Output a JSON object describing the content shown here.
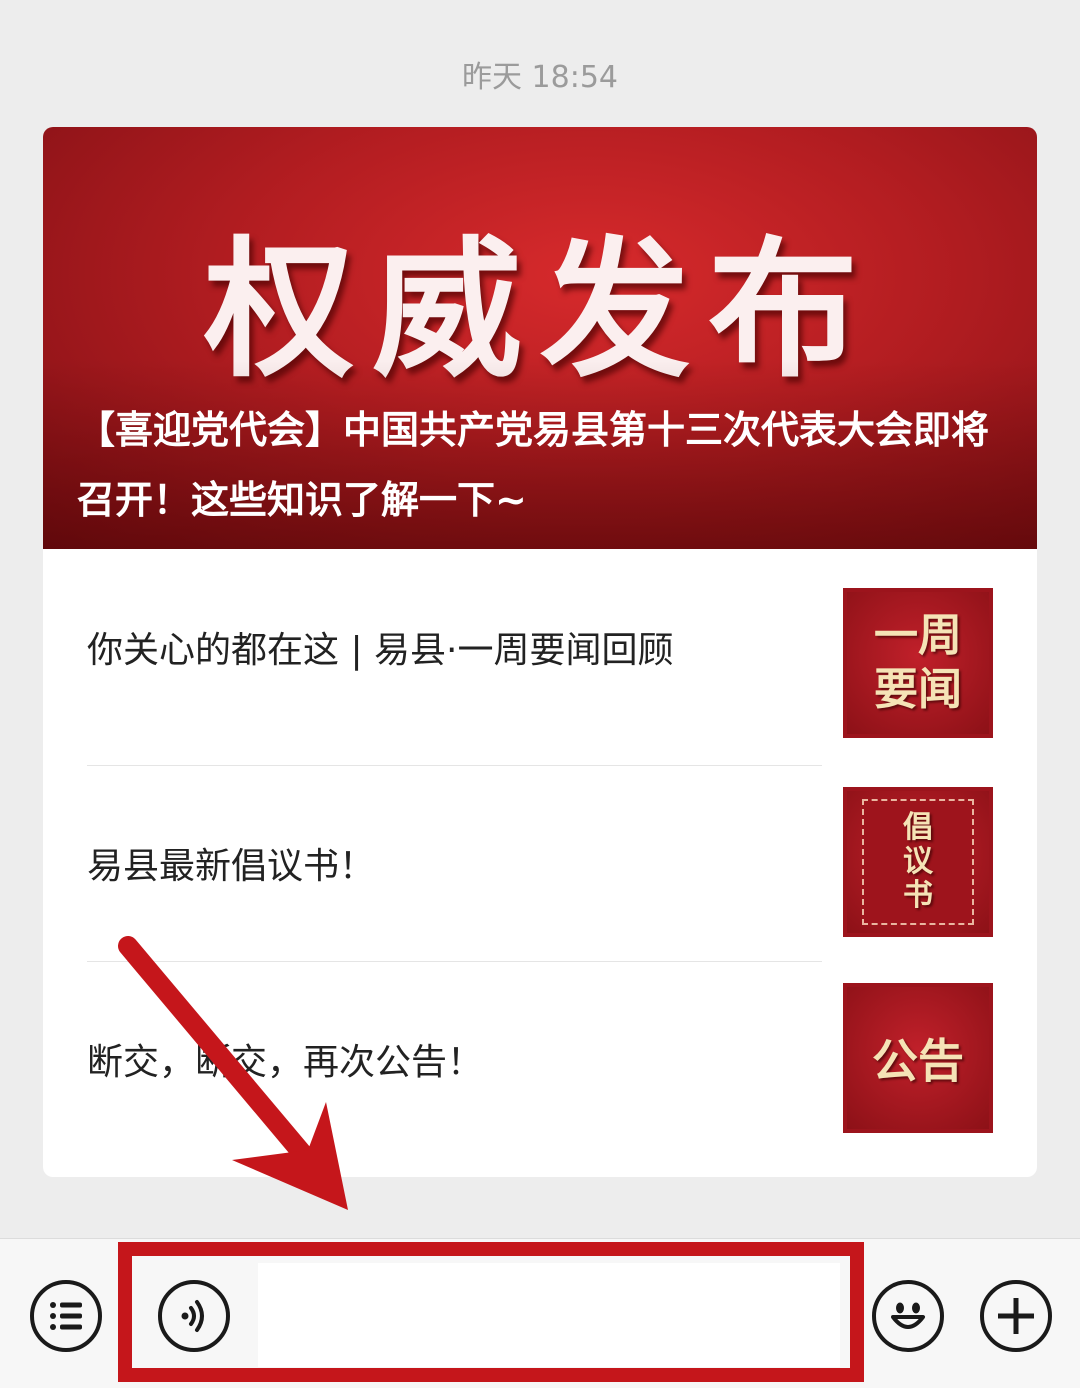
{
  "timestamp": "昨天 18:54",
  "article_card": {
    "banner": {
      "big_text": "权威发布",
      "title": "【喜迎党代会】中国共产党易县第十三次代表大会即将召开！这些知识了解一下~"
    },
    "items": [
      {
        "title": "你关心的都在这 | 易县·一周要闻回顾",
        "thumb_text": "一周要闻"
      },
      {
        "title": "易县最新倡议书！",
        "thumb_text": "倡议书"
      },
      {
        "title": "断交，断交，再次公告！",
        "thumb_text": "公告"
      }
    ]
  },
  "bottom_bar": {
    "icons": [
      "menu-icon",
      "voice-icon",
      "emoji-icon",
      "plus-icon"
    ],
    "input_value": ""
  },
  "annotation": {
    "color": "#c5161b"
  }
}
